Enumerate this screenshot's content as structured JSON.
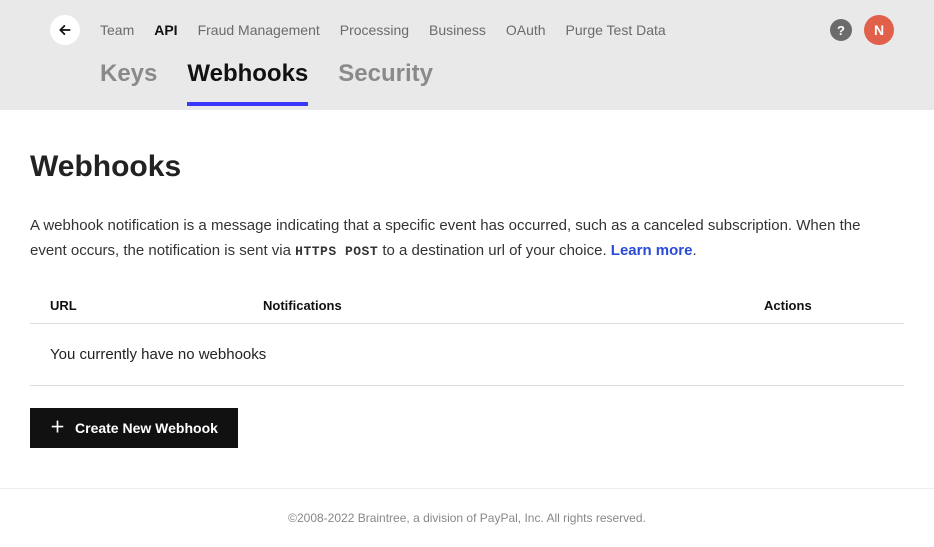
{
  "nav": {
    "items": [
      {
        "label": "Team",
        "active": false
      },
      {
        "label": "API",
        "active": true
      },
      {
        "label": "Fraud Management",
        "active": false
      },
      {
        "label": "Processing",
        "active": false
      },
      {
        "label": "Business",
        "active": false
      },
      {
        "label": "OAuth",
        "active": false
      },
      {
        "label": "Purge Test Data",
        "active": false
      }
    ],
    "help_label": "?",
    "avatar_initial": "N"
  },
  "tabs": [
    {
      "label": "Keys",
      "active": false
    },
    {
      "label": "Webhooks",
      "active": true
    },
    {
      "label": "Security",
      "active": false
    }
  ],
  "page": {
    "title": "Webhooks",
    "desc_pre": "A webhook notification is a message indicating that a specific event has occurred, such as a canceled subscription. When the event occurs, the notification is sent via ",
    "desc_code": "HTTPS POST",
    "desc_post": " to a destination url of your choice. ",
    "learn_more": "Learn more",
    "desc_end": "."
  },
  "table": {
    "col_url": "URL",
    "col_notifications": "Notifications",
    "col_actions": "Actions",
    "empty": "You currently have no webhooks"
  },
  "actions": {
    "create_label": "Create New Webhook"
  },
  "footer": {
    "text": "©2008-2022 Braintree, a division of PayPal, Inc. All rights reserved."
  }
}
